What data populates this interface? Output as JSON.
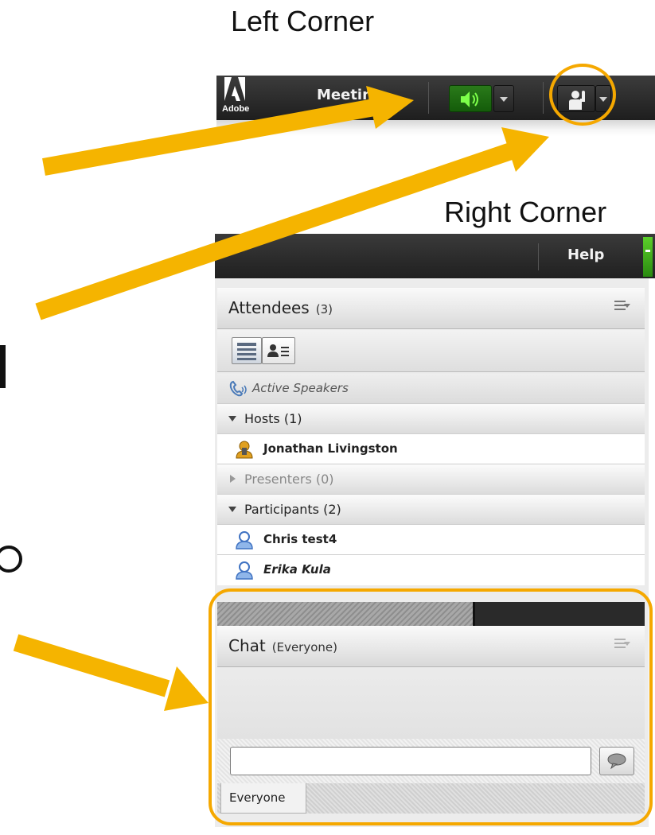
{
  "captions": {
    "left_corner": "Left Corner",
    "right_corner": "Right Corner"
  },
  "toolbar": {
    "brand": "Adobe",
    "meeting_menu": "Meeting",
    "audio_icon": "speaker-icon",
    "raise_hand_icon": "raise-hand-icon"
  },
  "right_bar": {
    "help_menu": "Help"
  },
  "attendees_pod": {
    "title": "Attendees",
    "count": "(3)",
    "active_speakers": "Active Speakers",
    "groups": [
      {
        "label": "Hosts (1)",
        "expanded": true,
        "members": [
          "Jonathan Livingston"
        ]
      },
      {
        "label": "Presenters (0)",
        "expanded": false,
        "members": []
      },
      {
        "label": "Participants (2)",
        "expanded": true,
        "members": [
          "Chris test4",
          "Erika Kula"
        ]
      }
    ]
  },
  "chat_pod": {
    "title": "Chat",
    "scope": "(Everyone)",
    "input_value": "",
    "tab_label": "Everyone"
  },
  "colors": {
    "highlight": "#f5a800",
    "toolbar_bg": "#2a2a2a",
    "audio_green": "#1f6e12",
    "host_icon": "#e0a020",
    "participant_icon": "#5b8fd6"
  }
}
